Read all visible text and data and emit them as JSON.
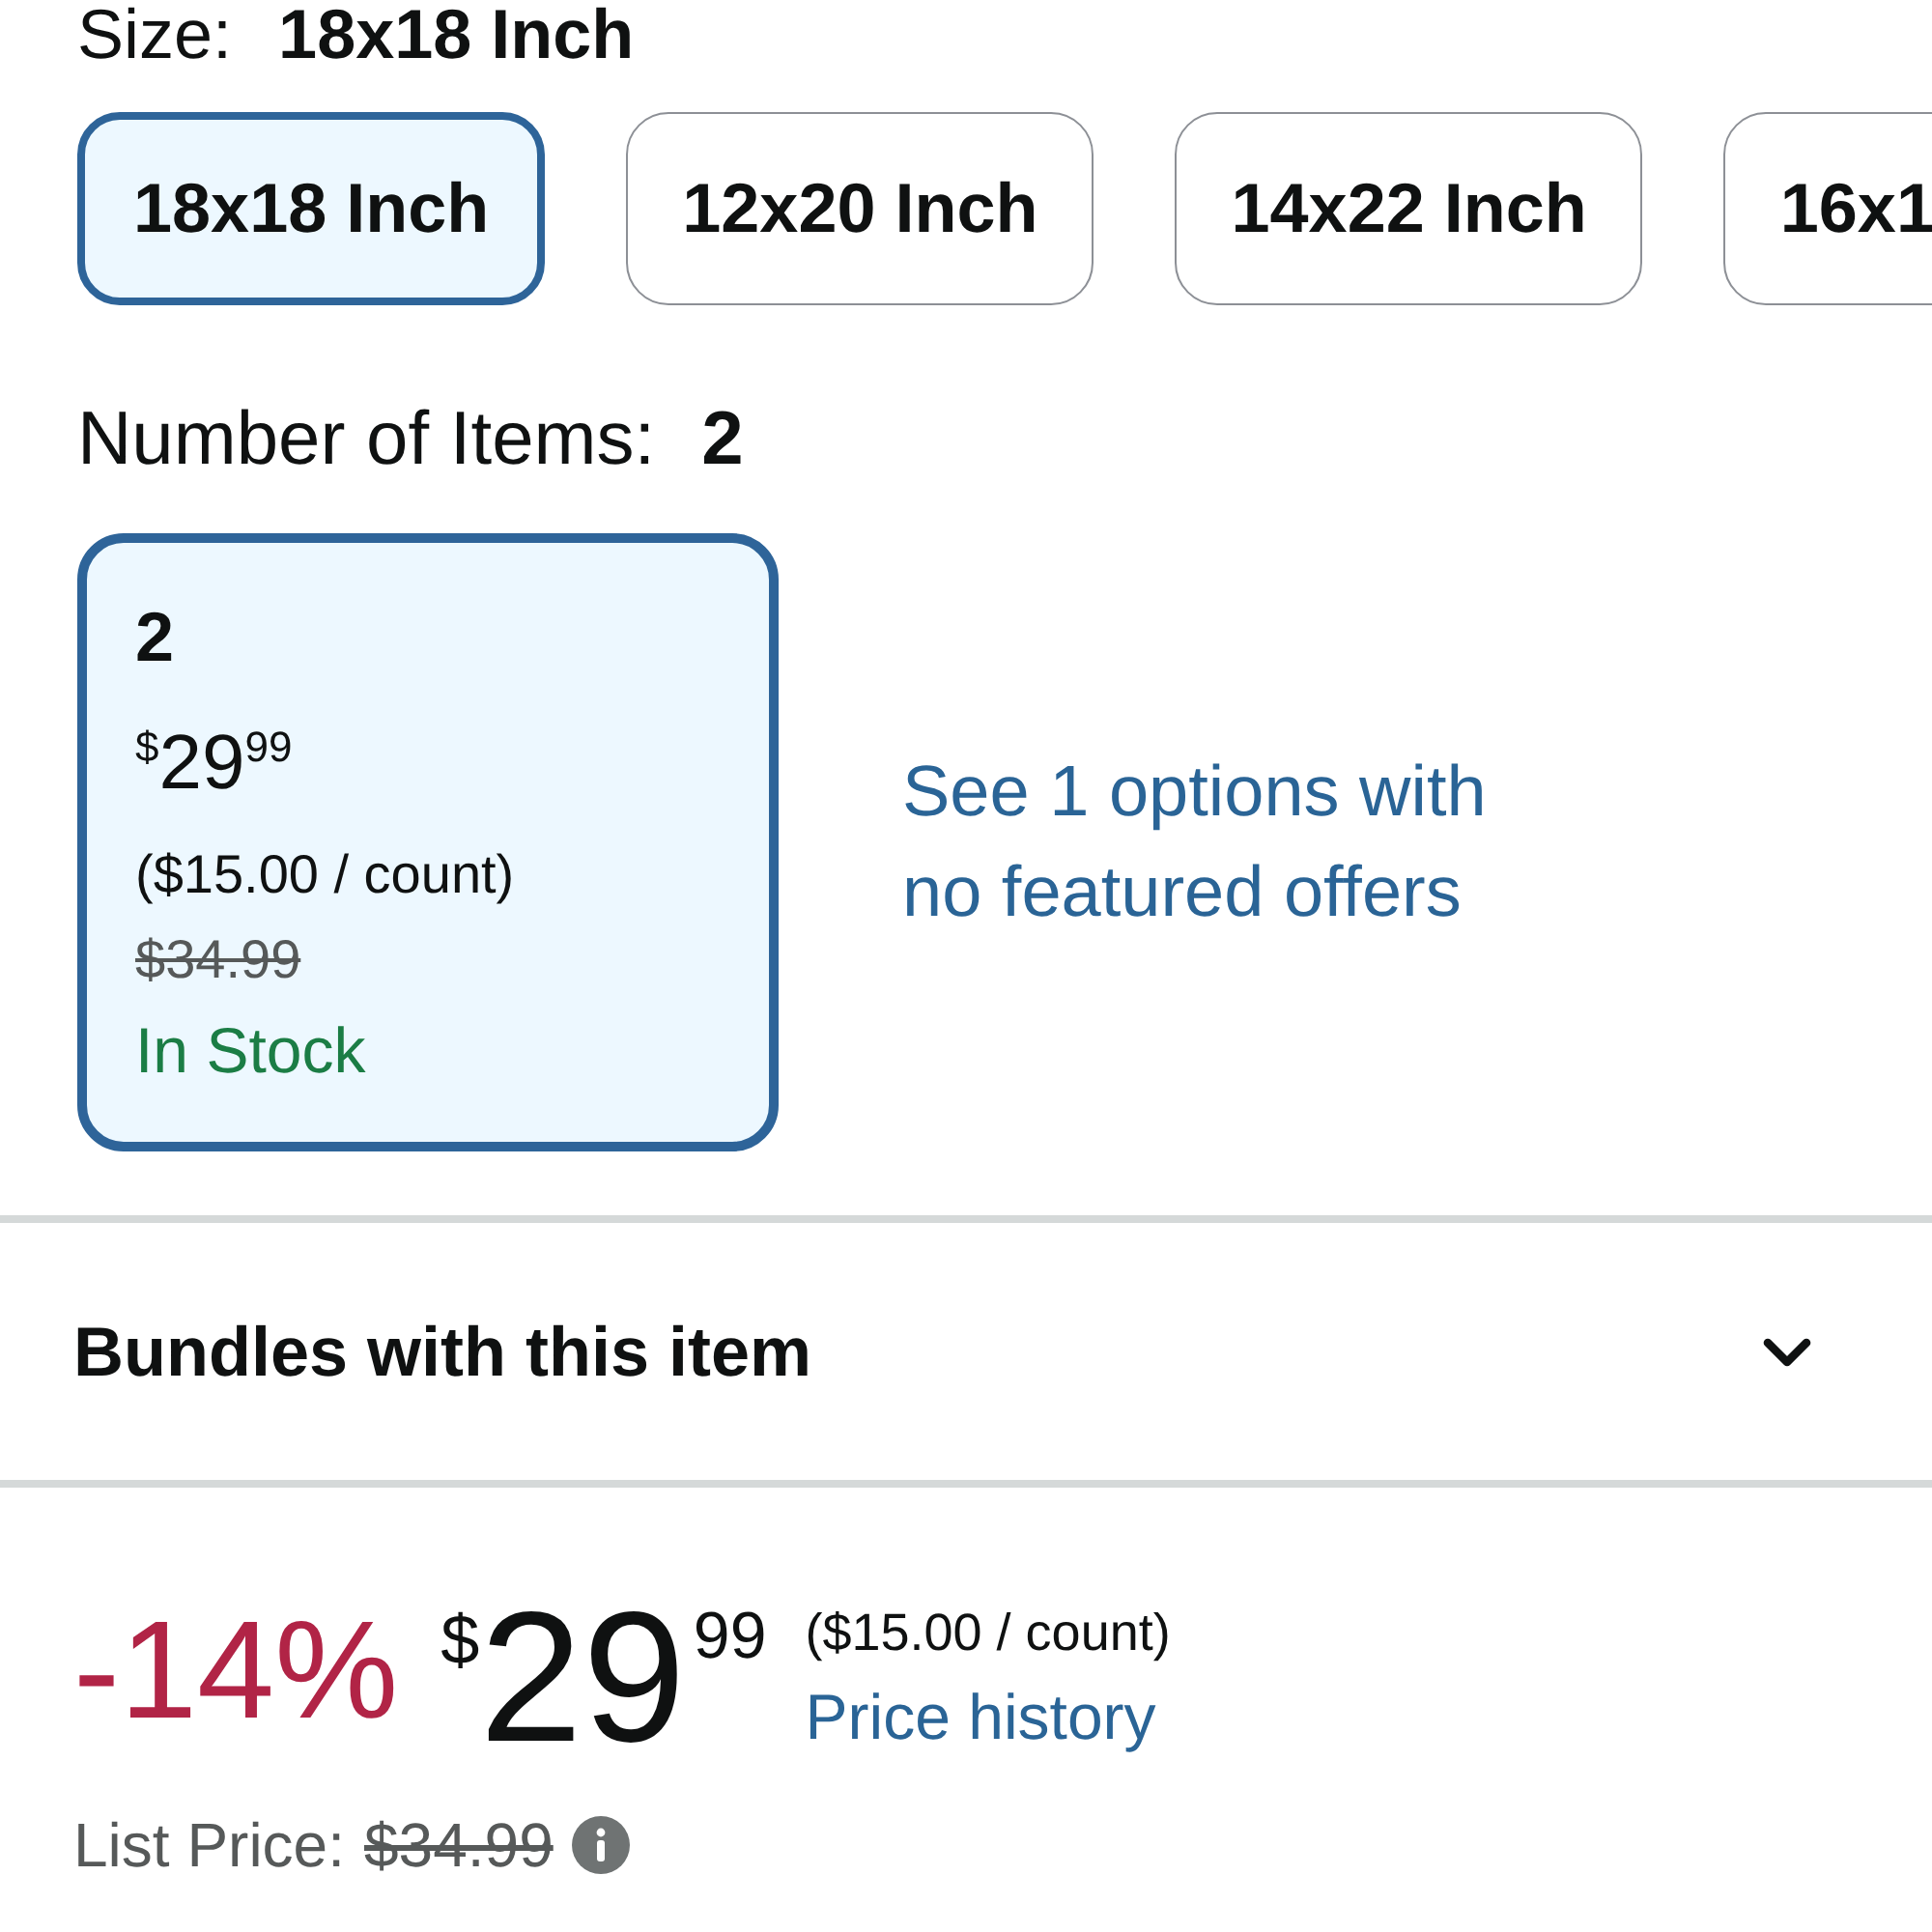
{
  "size": {
    "label": "Size:",
    "value": "18x18 Inch",
    "options": [
      {
        "label": "18x18 Inch",
        "selected": true
      },
      {
        "label": "12x20 Inch",
        "selected": false
      },
      {
        "label": "14x22 Inch",
        "selected": false
      },
      {
        "label": "16x1",
        "selected": false
      }
    ]
  },
  "number_of_items": {
    "label": "Number of Items:",
    "value": "2",
    "options": [
      {
        "label": "2",
        "price": {
          "symbol": "$",
          "whole": "29",
          "fraction": "99"
        },
        "unit_price": "($15.00 / count)",
        "list_price": "$34.99",
        "availability": "In Stock",
        "selected": true
      }
    ],
    "more_options_link": "See 1 options with no featured offers"
  },
  "bundles": {
    "title": "Bundles with this item",
    "expanded": false
  },
  "price_summary": {
    "savings": "-14%",
    "price": {
      "symbol": "$",
      "whole": "29",
      "fraction": "99"
    },
    "unit_price": "($15.00 / count)",
    "price_history_link": "Price history",
    "list_price": {
      "label": "List Price:",
      "value": "$34.99"
    }
  }
}
